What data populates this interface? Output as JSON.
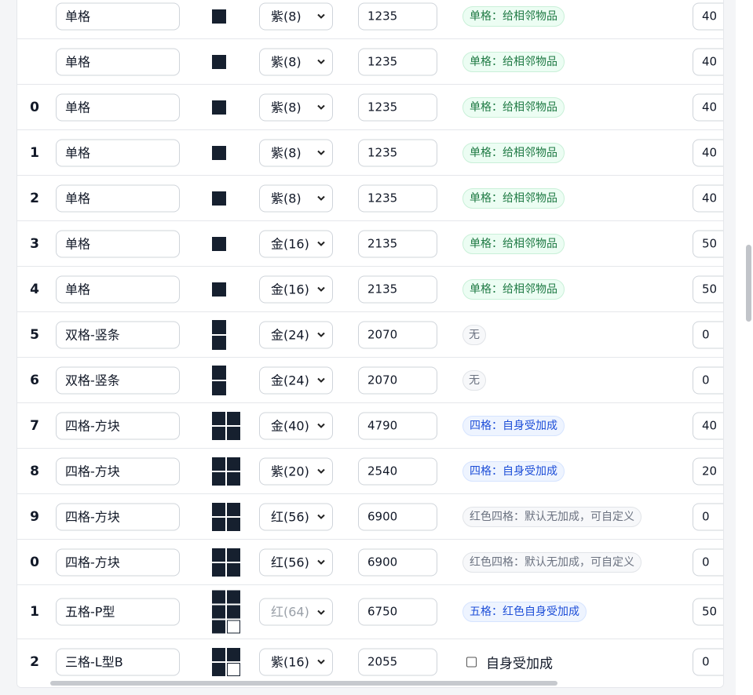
{
  "rows": [
    {
      "index": "",
      "name": "单格",
      "shape": "single",
      "quality": "紫(8)",
      "price": "1235",
      "effect": "单格：给相邻物品",
      "effect_style": "green",
      "extra": "40"
    },
    {
      "index": "",
      "name": "单格",
      "shape": "single",
      "quality": "紫(8)",
      "price": "1235",
      "effect": "单格：给相邻物品",
      "effect_style": "green",
      "extra": "40"
    },
    {
      "index": "0",
      "name": "单格",
      "shape": "single",
      "quality": "紫(8)",
      "price": "1235",
      "effect": "单格：给相邻物品",
      "effect_style": "green",
      "extra": "40"
    },
    {
      "index": "1",
      "name": "单格",
      "shape": "single",
      "quality": "紫(8)",
      "price": "1235",
      "effect": "单格：给相邻物品",
      "effect_style": "green",
      "extra": "40"
    },
    {
      "index": "2",
      "name": "单格",
      "shape": "single",
      "quality": "紫(8)",
      "price": "1235",
      "effect": "单格：给相邻物品",
      "effect_style": "green",
      "extra": "40"
    },
    {
      "index": "3",
      "name": "单格",
      "shape": "single",
      "quality": "金(16)",
      "price": "2135",
      "effect": "单格：给相邻物品",
      "effect_style": "green",
      "extra": "50"
    },
    {
      "index": "4",
      "name": "单格",
      "shape": "single",
      "quality": "金(16)",
      "price": "2135",
      "effect": "单格：给相邻物品",
      "effect_style": "green",
      "extra": "50"
    },
    {
      "index": "5",
      "name": "双格-竖条",
      "shape": "double-vertical",
      "quality": "金(24)",
      "price": "2070",
      "effect": "无",
      "effect_style": "gray-none",
      "extra": "0"
    },
    {
      "index": "6",
      "name": "双格-竖条",
      "shape": "double-vertical",
      "quality": "金(24)",
      "price": "2070",
      "effect": "无",
      "effect_style": "gray-none",
      "extra": "0"
    },
    {
      "index": "7",
      "name": "四格-方块",
      "shape": "square-4",
      "quality": "金(40)",
      "price": "4790",
      "effect": "四格：自身受加成",
      "effect_style": "blue",
      "extra": "40"
    },
    {
      "index": "8",
      "name": "四格-方块",
      "shape": "square-4",
      "quality": "紫(20)",
      "price": "2540",
      "effect": "四格：自身受加成",
      "effect_style": "blue",
      "extra": "20"
    },
    {
      "index": "9",
      "name": "四格-方块",
      "shape": "square-4",
      "quality": "红(56)",
      "price": "6900",
      "effect": "红色四格：默认无加成，可自定义",
      "effect_style": "gray",
      "extra": "0"
    },
    {
      "index": "0",
      "name": "四格-方块",
      "shape": "square-4",
      "quality": "红(56)",
      "price": "6900",
      "effect": "红色四格：默认无加成，可自定义",
      "effect_style": "gray",
      "extra": "0"
    },
    {
      "index": "1",
      "name": "五格-P型",
      "shape": "p-5",
      "quality": "红(64)",
      "quality_disabled": true,
      "price": "6750",
      "effect": "五格：红色自身受加成",
      "effect_style": "blue",
      "extra": "50"
    },
    {
      "index": "2",
      "name": "三格-L型B",
      "shape": "l-3",
      "quality": "紫(16)",
      "price": "2055",
      "effect": "",
      "checkbox_label": "自身受加成",
      "effect_style": "checkbox",
      "extra": "0"
    }
  ],
  "colors": {
    "shape_fill": "#16202f",
    "green_badge": "#1f7a44",
    "blue_badge": "#1d4ed8"
  },
  "icons": {
    "select": "chevron-down-icon",
    "checkbox": "checkbox-icon"
  }
}
